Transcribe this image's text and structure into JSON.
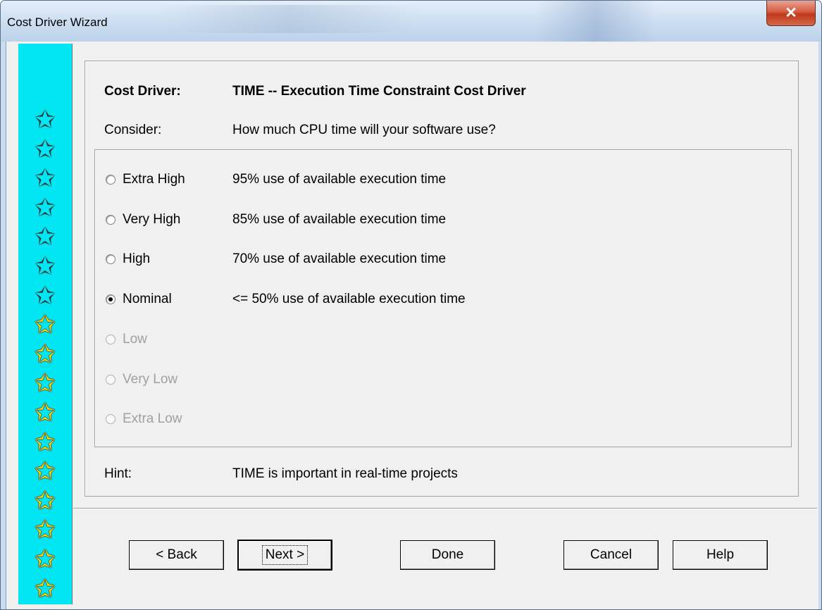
{
  "window": {
    "title": "Cost Driver Wizard",
    "close_glyph": "✕"
  },
  "stars": {
    "empty_count": 7,
    "filled_count": 10,
    "glyph": "✩",
    "filled_color": "#f3e300",
    "strip_color": "#00e6f2"
  },
  "header": {
    "cost_driver_label": "Cost Driver:",
    "cost_driver_value": "TIME -- Execution Time Constraint Cost Driver",
    "consider_label": "Consider:",
    "consider_value": "How much CPU time will your software use?"
  },
  "options": [
    {
      "label": "Extra High",
      "description": "95% use of available execution time",
      "selected": false,
      "enabled": true
    },
    {
      "label": "Very High",
      "description": "85% use of available execution time",
      "selected": false,
      "enabled": true
    },
    {
      "label": "High",
      "description": "70% use of available execution time",
      "selected": false,
      "enabled": true
    },
    {
      "label": "Nominal",
      "description": "<= 50% use of available execution time",
      "selected": true,
      "enabled": true
    },
    {
      "label": "Low",
      "description": "",
      "selected": false,
      "enabled": false
    },
    {
      "label": "Very Low",
      "description": "",
      "selected": false,
      "enabled": false
    },
    {
      "label": "Extra Low",
      "description": "",
      "selected": false,
      "enabled": false
    }
  ],
  "hint": {
    "label": "Hint:",
    "value": "TIME is important in real-time projects"
  },
  "buttons": {
    "back": "< Back",
    "next": "Next >",
    "done": "Done",
    "cancel": "Cancel",
    "help": "Help"
  }
}
